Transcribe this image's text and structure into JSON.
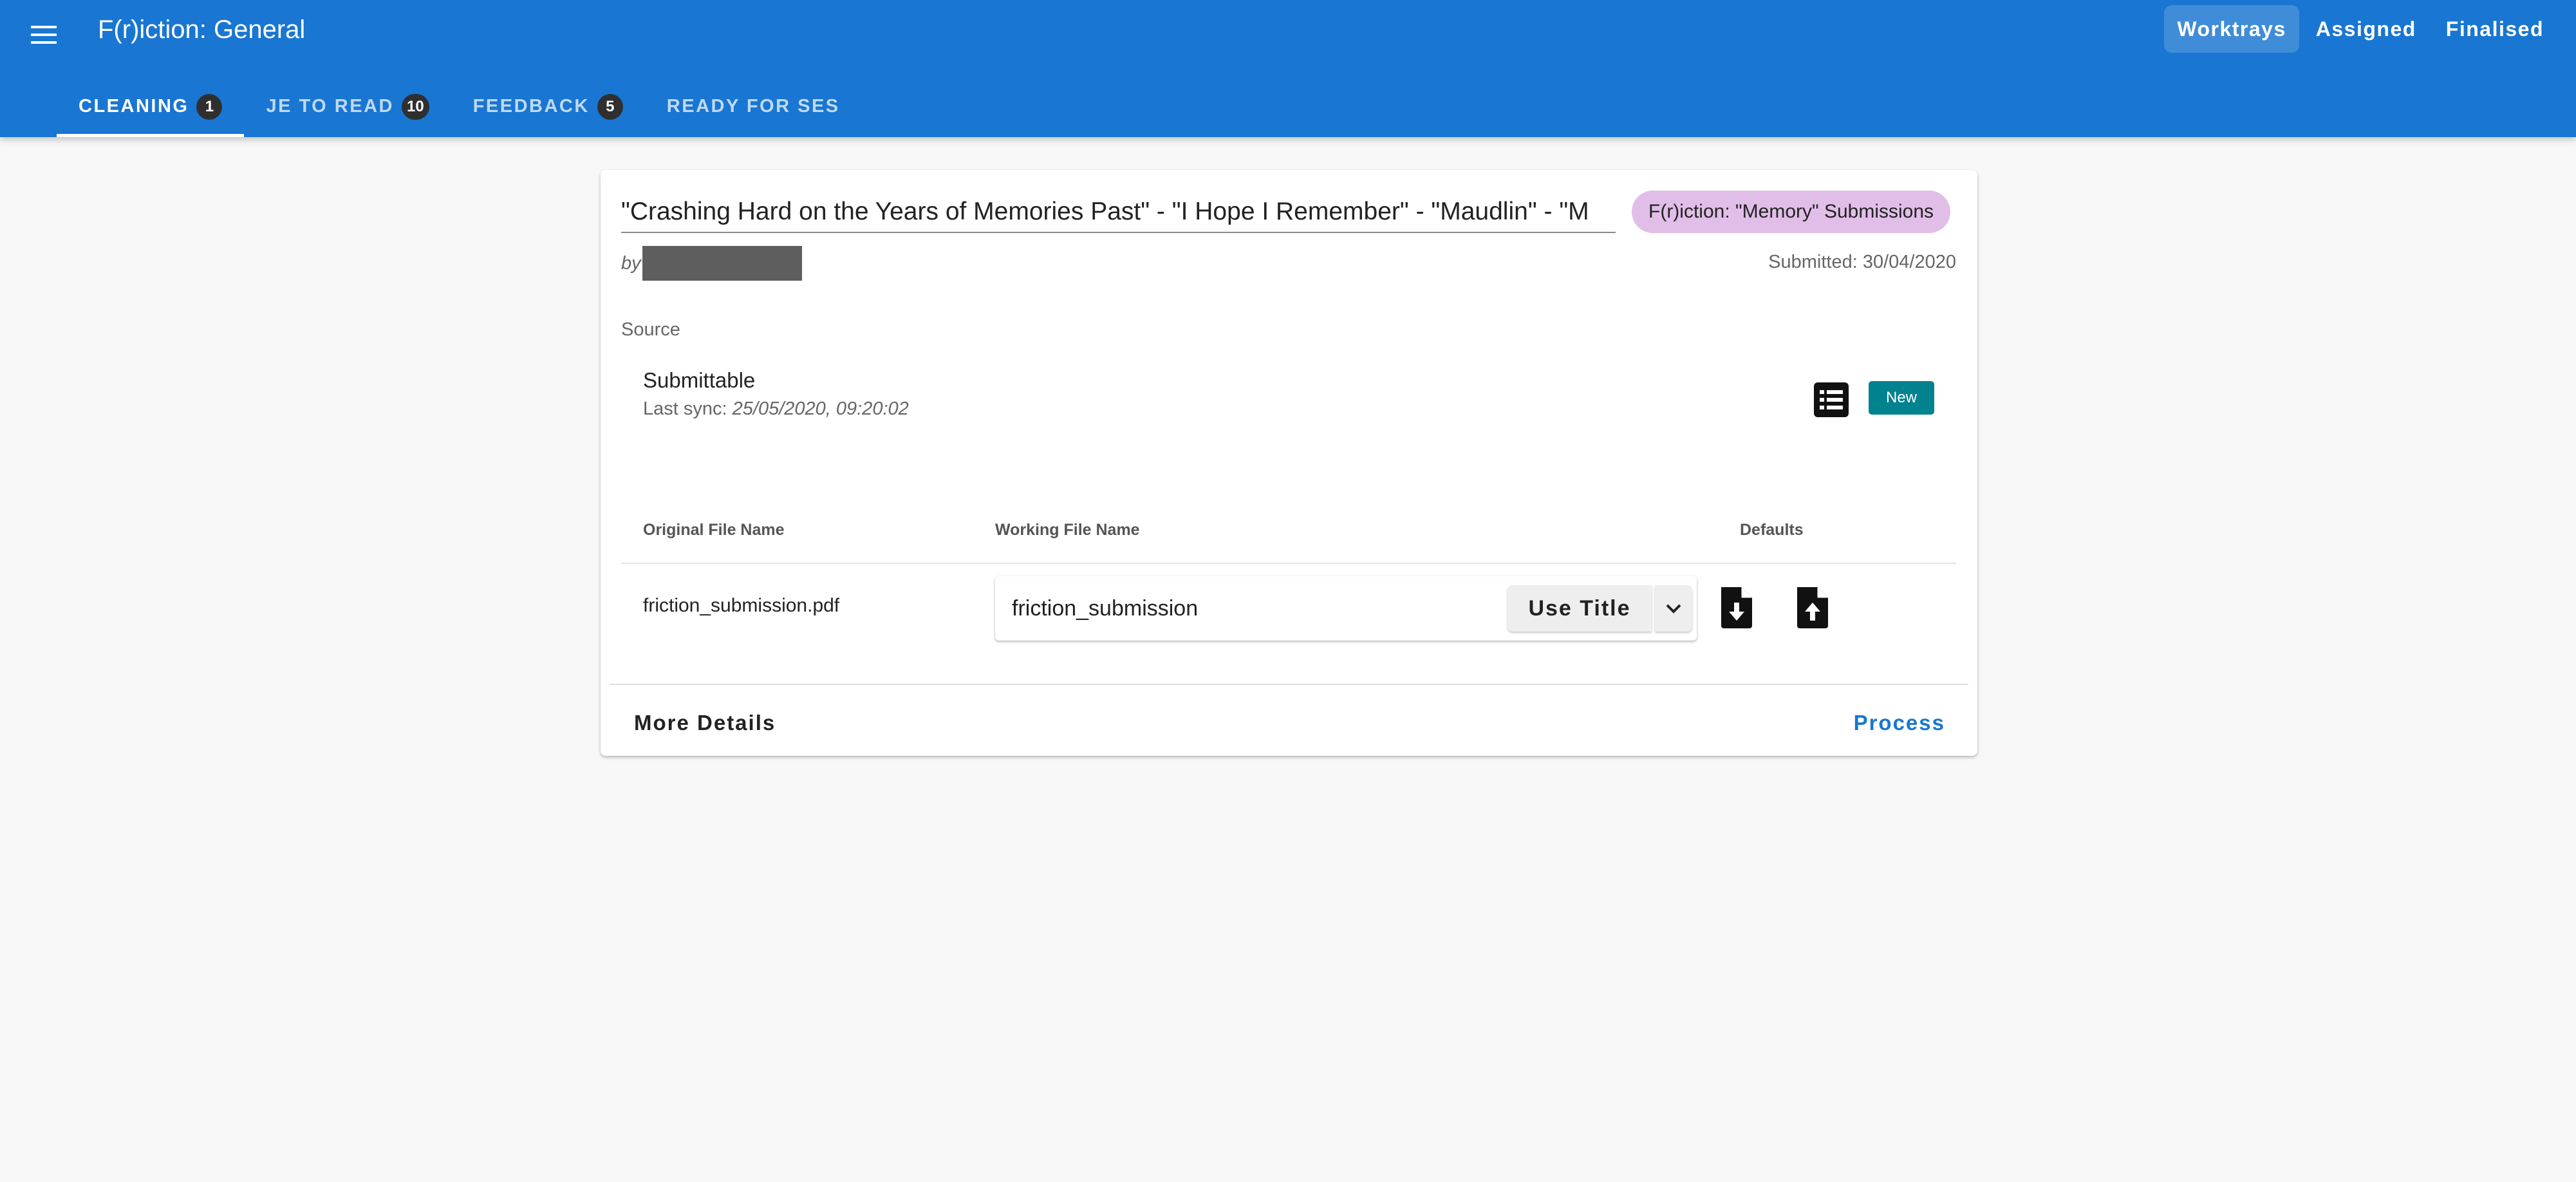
{
  "app": {
    "title": "F(r)iction: General"
  },
  "topnav": {
    "worktrays": "Worktrays",
    "assigned": "Assigned",
    "finalised": "Finalised"
  },
  "tabs": [
    {
      "label": "CLEANING",
      "count": "1"
    },
    {
      "label": "JE TO READ",
      "count": "10"
    },
    {
      "label": "FEEDBACK",
      "count": "5"
    },
    {
      "label": "READY FOR SES"
    }
  ],
  "submission": {
    "title": "\"Crashing Hard on the Years of Memories Past\" - \"I Hope I Remember\" - \"Maudlin\" - \"M",
    "collection": "F(r)iction: \"Memory\" Submissions",
    "by": "by",
    "submitted": "Submitted: 30/04/2020"
  },
  "source": {
    "label": "Source",
    "name": "Submittable",
    "sync_label": "Last sync: ",
    "sync_time": "25/05/2020, 09:20:02",
    "status": "New"
  },
  "files": {
    "headers": {
      "original": "Original File Name",
      "working": "Working File Name",
      "defaults": "Defaults"
    },
    "original_name": "friction_submission.pdf",
    "working_name": "friction_submission",
    "use_title_label": "Use Title"
  },
  "actions": {
    "more_details": "More Details",
    "process": "Process"
  },
  "colors": {
    "primary": "#1976d2",
    "chip": "#e1bee7",
    "new_badge": "#00838f"
  }
}
